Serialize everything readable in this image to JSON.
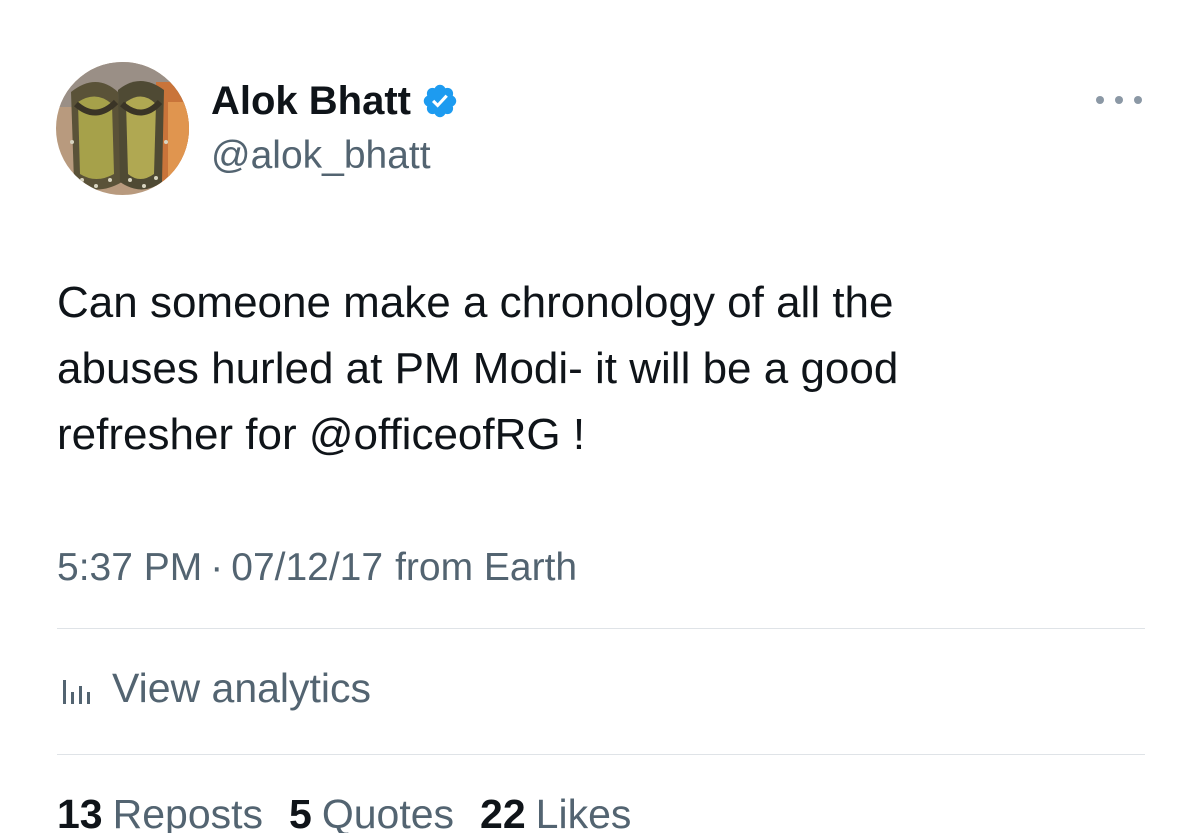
{
  "author": {
    "display_name": "Alok Bhatt",
    "handle": "@alok_bhatt",
    "verified": true,
    "avatar_icon": "sandals-photo-avatar"
  },
  "tweet": {
    "text_before_mention": "Can someone make a chronology of all the\nabuses hurled at PM Modi- it will be a good\nrefresher for ",
    "mention": "@officeofRG",
    "text_after_mention": " !"
  },
  "meta": {
    "time": "5:37 PM",
    "separator": "·",
    "date": "07/12/17",
    "source": "from Earth"
  },
  "analytics": {
    "icon": "analytics-bars-icon",
    "label": "View analytics"
  },
  "stats": {
    "reposts_count": "13",
    "reposts_label": "Reposts",
    "quotes_count": "5",
    "quotes_label": "Quotes",
    "likes_count": "22",
    "likes_label": "Likes"
  },
  "colors": {
    "text_primary": "#0f1419",
    "text_secondary": "#536471",
    "verified_blue": "#1d9bf0",
    "divider": "#dfe3e7"
  }
}
